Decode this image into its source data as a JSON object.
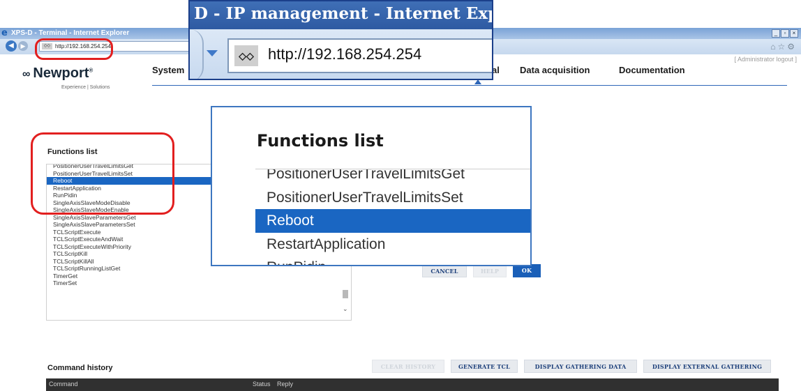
{
  "browser": {
    "window_title": "XPS-D - Terminal - Internet Explorer",
    "address": "http://192.168.254.254",
    "window_controls": [
      "_",
      "×"
    ],
    "toolbar_icons": [
      "home-icon",
      "star-icon",
      "gear-icon"
    ]
  },
  "header": {
    "brand": "Newport",
    "tagline": "Experience | Solutions",
    "admin_link": "[ Administrator logout ]",
    "nav": {
      "system": "System",
      "terminal_tail": "al",
      "data_acquisition": "Data acquisition",
      "documentation": "Documentation"
    }
  },
  "functions": {
    "title": "Functions list",
    "items": [
      "PositionerUserTravelLimitsGet",
      "PositionerUserTravelLimitsSet",
      "Reboot",
      "RestartApplication",
      "RunPidin",
      "SingleAxisSlaveModeDisable",
      "SingleAxisSlaveModeEnable",
      "SingleAxisSlaveParametersGet",
      "SingleAxisSlaveParametersSet",
      "TCLScriptExecute",
      "TCLScriptExecuteAndWait",
      "TCLScriptExecuteWithPriority",
      "TCLScriptKill",
      "TCLScriptKillAll",
      "TCLScriptRunningListGet",
      "TimerGet",
      "TimerSet"
    ],
    "selected": "Reboot"
  },
  "buttons": {
    "cancel": "CANCEL",
    "help": "HELP",
    "ok": "OK",
    "clear_history": "CLEAR HISTORY",
    "generate_tcl": "GENERATE TCL",
    "display_gathering": "DISPLAY GATHERING DATA",
    "display_external": "DISPLAY EXTERNAL GATHERING"
  },
  "history": {
    "title": "Command history",
    "col_command": "Command",
    "col_status": "Status",
    "col_reply": "Reply"
  },
  "zoom_address": {
    "title": "D - IP management - Internet Explo",
    "address": "http://192.168.254.254"
  },
  "zoom_functions": {
    "title": "Functions list",
    "items": [
      "PositionerUserTravelLimitsGet",
      "PositionerUserTravelLimitsSet",
      "Reboot",
      "RestartApplication",
      "RunPidin"
    ]
  },
  "colors": {
    "accent": "#1a66c2",
    "highlight_ring": "#e21f1f",
    "history_bar": "#303030"
  }
}
